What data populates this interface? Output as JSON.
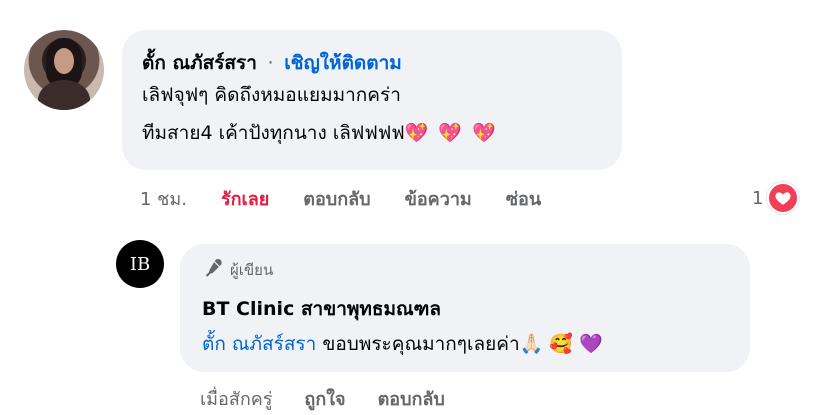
{
  "comment": {
    "author": "ตั้ก ณภัสร์สรา",
    "separator": "·",
    "follow_label": "เชิญให้ติดตาม",
    "text_line1": "เลิฟจุฟๆ คิดถึงหมอแยมมากคร่า",
    "text_line2": "ทีมสาย4 เค้าปังทุกนาง เลิฟฟฟฟ",
    "hearts": "💖 💖 💖",
    "time": "1 ชม.",
    "reaction_label": "รักเลย",
    "reply_label": "ตอบกลับ",
    "message_label": "ข้อความ",
    "hide_label": "ซ่อน",
    "reaction_count": "1",
    "reaction_icon": "heart-icon",
    "love_color": "#e41e3f"
  },
  "reply": {
    "avatar_text": "IB",
    "author_badge": "ผู้เขียน",
    "page_name": "BT Clinic สาขาพุทธมณฑล",
    "mention": "ตั้ก ณภัสร์สรา",
    "text": "ขอบพระคุณมากๆเลยค่า",
    "emojis": "🙏🏻 🥰 💜",
    "time": "เมื่อสักครู่",
    "like_label": "ถูกใจ",
    "reply_label": "ตอบกลับ",
    "mention_color": "#0064d1"
  }
}
